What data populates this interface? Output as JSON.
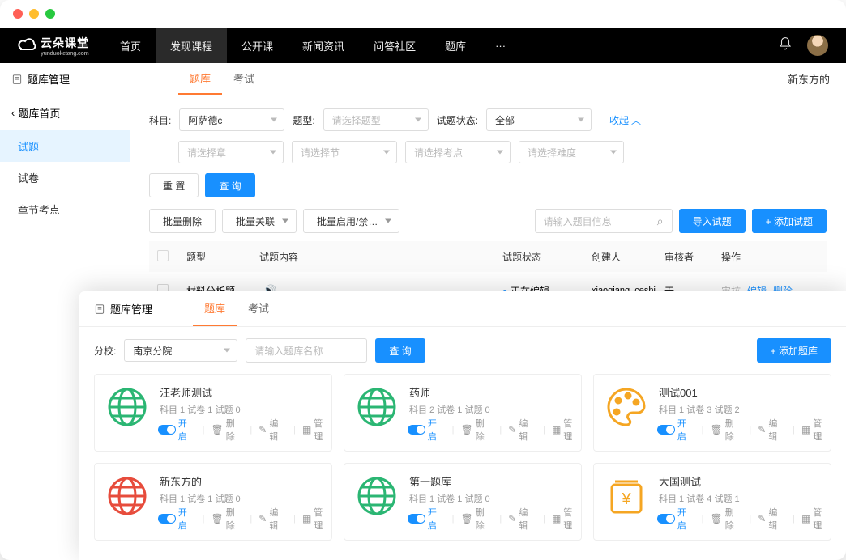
{
  "logo": {
    "main": "云朵课堂",
    "sub": "yunduoketang.com"
  },
  "nav": [
    "首页",
    "发现课程",
    "公开课",
    "新闻资讯",
    "问答社区",
    "题库",
    "···"
  ],
  "nav_active_index": 1,
  "sub_header": {
    "title": "题库管理",
    "tabs": [
      "题库",
      "考试"
    ],
    "active_tab": 0,
    "right_text": "新东方的"
  },
  "sidebar": {
    "back": "题库首页",
    "items": [
      "试题",
      "试卷",
      "章节考点"
    ],
    "active_index": 0
  },
  "filters": {
    "row1": [
      {
        "label": "科目:",
        "value": "阿萨德c"
      },
      {
        "label": "题型:",
        "value": "请选择题型",
        "placeholder": true
      },
      {
        "label": "试题状态:",
        "value": "全部"
      }
    ],
    "collapse": "收起",
    "row2": [
      {
        "value": "请选择章",
        "placeholder": true
      },
      {
        "value": "请选择节",
        "placeholder": true
      },
      {
        "value": "请选择考点",
        "placeholder": true
      },
      {
        "value": "请选择难度",
        "placeholder": true
      }
    ],
    "reset": "重 置",
    "search": "查 询"
  },
  "toolbar": {
    "batch_delete": "批量删除",
    "batch_link": "批量关联",
    "batch_toggle": "批量启用/禁…",
    "search_placeholder": "请输入题目信息",
    "import": "导入试题",
    "add": "+ 添加试题"
  },
  "table": {
    "headers": {
      "type": "题型",
      "content": "试题内容",
      "status": "试题状态",
      "creator": "创建人",
      "reviewer": "审核者",
      "actions": "操作"
    },
    "rows": [
      {
        "type": "材料分析题",
        "has_audio": true,
        "status": "正在编辑",
        "creator": "xiaoqiang_ceshi",
        "reviewer": "无",
        "actions": [
          "审核",
          "编辑",
          "删除"
        ]
      }
    ]
  },
  "overlay": {
    "title": "题库管理",
    "tabs": [
      "题库",
      "考试"
    ],
    "active_tab": 0,
    "branch_label": "分校:",
    "branch_value": "南京分院",
    "search_placeholder": "请输入题库名称",
    "search_btn": "查 询",
    "add_btn": "+ 添加题库",
    "card_actions": {
      "toggle_on": "开启",
      "delete": "删除",
      "edit": "编辑",
      "manage": "管理"
    },
    "cards": [
      {
        "title": "汪老师测试",
        "meta": "科目 1  试卷 1  试题 0",
        "icon": "globe-green"
      },
      {
        "title": "药师",
        "meta": "科目 2  试卷 1  试题 0",
        "icon": "globe-green"
      },
      {
        "title": "测试001",
        "meta": "科目 1  试卷 3  试题 2",
        "icon": "palette-orange"
      },
      {
        "title": "新东方的",
        "meta": "科目 1  试卷 1  试题 0",
        "icon": "globe-red"
      },
      {
        "title": "第一题库",
        "meta": "科目 1  试卷 1  试题 0",
        "icon": "globe-green"
      },
      {
        "title": "大国测试",
        "meta": "科目 1  试卷 4  试题 1",
        "icon": "money-orange"
      }
    ]
  }
}
